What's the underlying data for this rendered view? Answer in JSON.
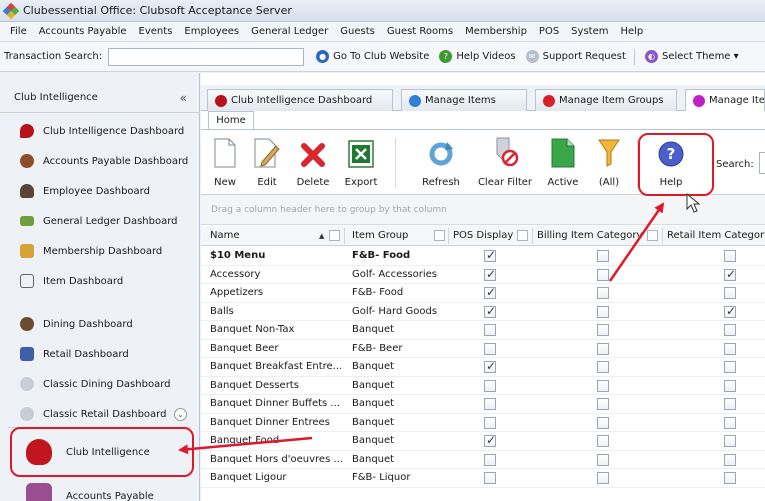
{
  "window": {
    "title": "Clubessential Office: Clubsoft Acceptance Server"
  },
  "menu": [
    "File",
    "Accounts Payable",
    "Events",
    "Employees",
    "General Ledger",
    "Guests",
    "Guest Rooms",
    "Membership",
    "POS",
    "System",
    "Help"
  ],
  "toolbar": {
    "transaction_search_label": "Transaction Search:",
    "transaction_search_value": "",
    "links": [
      "Go To Club Website",
      "Help Videos",
      "Support Request",
      "Select Theme ▾"
    ]
  },
  "sidebar": {
    "header": "Club Intelligence",
    "collapse_glyph": "«",
    "more_glyph": "⌄",
    "items": [
      "Club Intelligence Dashboard",
      "Accounts Payable Dashboard",
      "Employee Dashboard",
      "General Ledger Dashboard",
      "Membership Dashboard",
      "Item Dashboard",
      "Dining Dashboard",
      "Retail Dashboard",
      "Classic Dining Dashboard",
      "Classic Retail Dashboard"
    ],
    "modules": [
      "Club Intelligence",
      "Accounts Payable"
    ]
  },
  "doc_tabs": [
    "Club Intelligence Dashboard",
    "Manage Items",
    "Manage Item Groups",
    "Manage Ite"
  ],
  "ribbon": {
    "tab": "Home",
    "buttons": [
      "New",
      "Edit",
      "Delete",
      "Export",
      "Refresh",
      "Clear Filter",
      "Active",
      "(All)",
      "Help"
    ],
    "search_label": "Search:"
  },
  "grid": {
    "group_hint": "Drag a column header here to group by that column",
    "columns": [
      "Name",
      "Item Group",
      "POS Display",
      "Billing Item Category",
      "Retail Item Category"
    ],
    "rows": [
      {
        "name": "$10 Menu",
        "group": "F&B- Food",
        "pos": true,
        "billing": false,
        "retail": false,
        "bold": true
      },
      {
        "name": "Accessory",
        "group": "Golf- Accessories",
        "pos": true,
        "billing": false,
        "retail": true,
        "bold": false
      },
      {
        "name": "Appetizers",
        "group": "F&B- Food",
        "pos": true,
        "billing": false,
        "retail": false,
        "bold": false
      },
      {
        "name": "Balls",
        "group": "Golf- Hard Goods",
        "pos": true,
        "billing": false,
        "retail": true,
        "bold": false
      },
      {
        "name": "Banquet Non-Tax",
        "group": "Banquet",
        "pos": false,
        "billing": false,
        "retail": false,
        "bold": false
      },
      {
        "name": "Banquet Beer",
        "group": "F&B- Beer",
        "pos": false,
        "billing": false,
        "retail": false,
        "bold": false
      },
      {
        "name": "Banquet Breakfast Entre...",
        "group": "Banquet",
        "pos": true,
        "billing": false,
        "retail": false,
        "bold": false
      },
      {
        "name": "Banquet Desserts",
        "group": "Banquet",
        "pos": false,
        "billing": false,
        "retail": false,
        "bold": false
      },
      {
        "name": "Banquet Dinner Buffets ...",
        "group": "Banquet",
        "pos": false,
        "billing": false,
        "retail": false,
        "bold": false
      },
      {
        "name": "Banquet Dinner Entrees",
        "group": "Banquet",
        "pos": false,
        "billing": false,
        "retail": false,
        "bold": false
      },
      {
        "name": "Banquet Food",
        "group": "Banquet",
        "pos": true,
        "billing": false,
        "retail": false,
        "bold": false
      },
      {
        "name": "Banquet Hors d'oeuvres ...",
        "group": "Banquet",
        "pos": false,
        "billing": false,
        "retail": false,
        "bold": false
      },
      {
        "name": "Banquet Ligour",
        "group": "F&B- Liquor",
        "pos": false,
        "billing": false,
        "retail": false,
        "bold": false
      }
    ]
  },
  "colors": {
    "highlight": "#e0192a",
    "arrow": "#e0192a"
  }
}
